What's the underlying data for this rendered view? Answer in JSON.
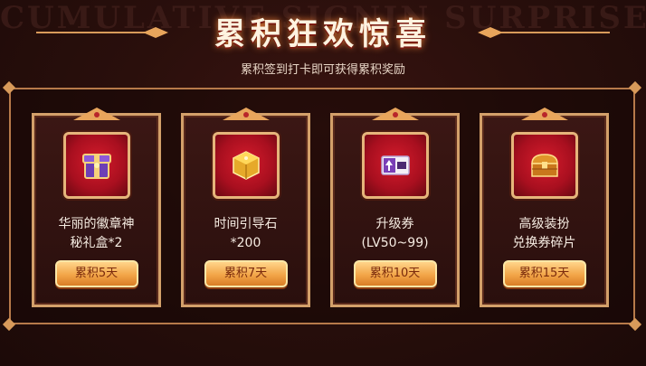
{
  "watermark": "CUMULATIVE SIGNIN SURPRISE",
  "title": "累积狂欢惊喜",
  "subtitle": "累积签到打卡即可获得累积奖励",
  "rewards": [
    {
      "line1": "华丽的徽章神",
      "line2": "秘礼盒*2",
      "button": "累积5天",
      "icon": "treasure-box-icon"
    },
    {
      "line1": "时间引导石",
      "line2": "*200",
      "button": "累积7天",
      "icon": "golden-cube-icon"
    },
    {
      "line1": "升级券",
      "line2": "(LV50~99)",
      "button": "累积10天",
      "icon": "level-ticket-icon"
    },
    {
      "line1": "高级装扮",
      "line2": "兑换券碎片",
      "button": "累积15天",
      "icon": "treasure-chest-icon"
    }
  ],
  "colors": {
    "accent": "#f2a548",
    "frame": "#d3a06a",
    "item_bg": "#a80f1f"
  }
}
